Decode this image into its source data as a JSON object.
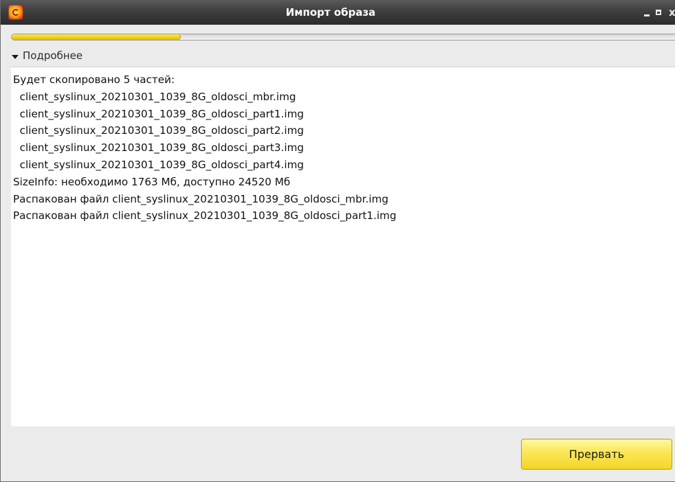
{
  "window": {
    "title": "Импорт образа",
    "controls": {
      "minimize_icon": "minimize-icon",
      "maximize_icon": "maximize-icon",
      "close_label": "x"
    }
  },
  "progress": {
    "value": 0.25,
    "fill_color": "#f3cf10"
  },
  "details": {
    "label": "Подробнее",
    "expanded": true
  },
  "log": {
    "lines": [
      "Будет скопировано 5 частей:",
      "  client_syslinux_20210301_1039_8G_oldosci_mbr.img",
      "  client_syslinux_20210301_1039_8G_oldosci_part1.img",
      "  client_syslinux_20210301_1039_8G_oldosci_part2.img",
      "  client_syslinux_20210301_1039_8G_oldosci_part3.img",
      "  client_syslinux_20210301_1039_8G_oldosci_part4.img",
      "SizeInfo: необходимо 1763 Мб, доступно 24520 Мб",
      "Распакован файл client_syslinux_20210301_1039_8G_oldosci_mbr.img",
      "Распакован файл client_syslinux_20210301_1039_8G_oldosci_part1.img"
    ]
  },
  "actions": {
    "abort_label": "Прервать"
  },
  "colors": {
    "titlebar": "#3e3e3e",
    "accent": "#f3d62a",
    "background": "#ebebeb"
  }
}
